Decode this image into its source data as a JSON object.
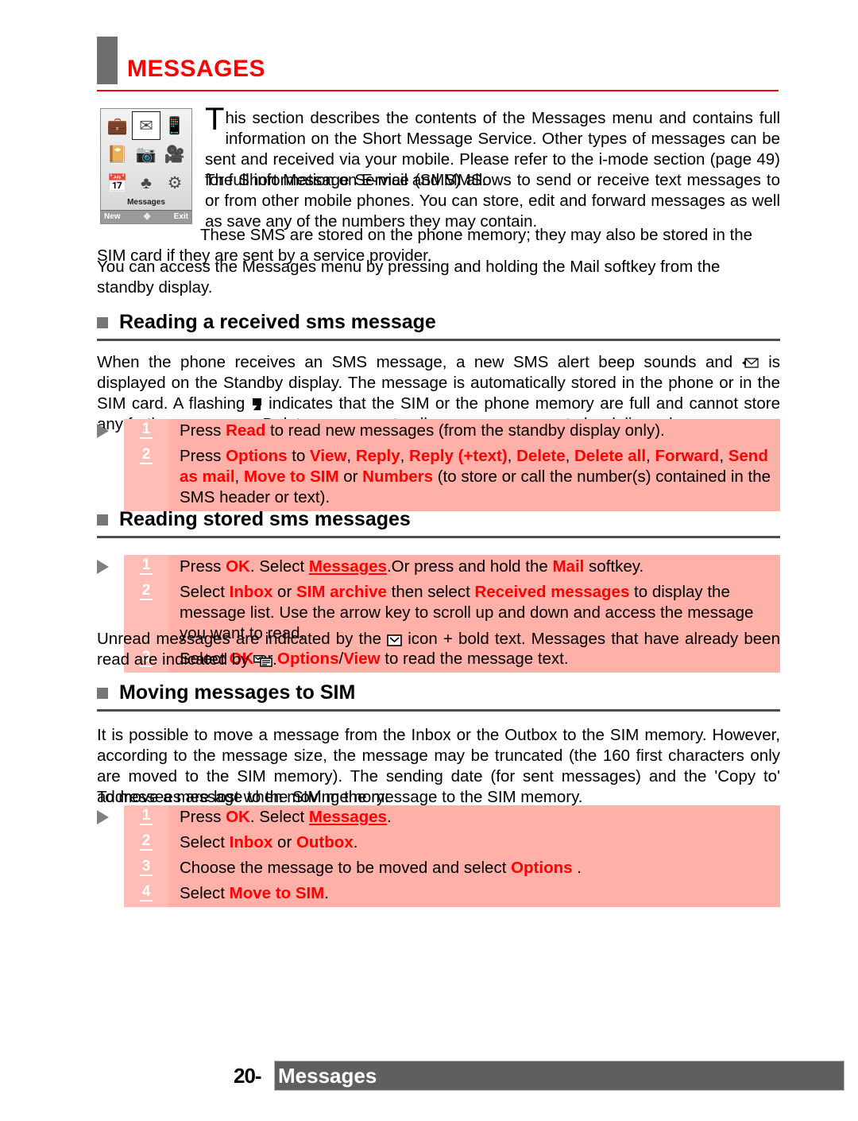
{
  "header": {
    "title": "MESSAGES"
  },
  "phone_screen": {
    "menu_label": "Messages",
    "softkey_left": "New",
    "softkey_center": "nav-pad",
    "softkey_right": "Exit",
    "icons": [
      "briefcase-icon",
      "envelope-icon",
      "phone-tools-icon",
      "notebook-icon",
      "camera-icon",
      "media-icon",
      "calendar-icon",
      "games-icon",
      "settings-icon"
    ]
  },
  "intro": {
    "dropcap": "T",
    "para1": "his section describes the contents of the Messages menu and contains full information on the Short Message Service. Other types of messages can be sent and received via your mobile. Please refer to the i-mode section (page 49) for full information on E-mail and MMS.",
    "para2": "The Short Message Service (SMS) allows to send or receive text messages to or from other mobile phones. You can store, edit and forward messages as well as save any of the numbers they may contain.",
    "para3": "These SMS are stored on the phone memory; they may also be stored in the SIM card if they are sent by a service provider.",
    "para4": "You can access the Messages menu by pressing and holding the Mail softkey from the standby display."
  },
  "section1": {
    "title": "Reading a received sms message",
    "body_pre_icon": "When the phone receives an SMS message, a new SMS alert beep sounds and ",
    "body_mid_icon": " is displayed on the Standby display. The message is automatically stored in the phone or in the SIM card. A flashing ",
    "body_post_icon": " indicates that the SIM or the phone memory are full and cannot store any further messages. Delete messages to allow new messages to be delivered.",
    "steps": [
      {
        "num": "1",
        "parts": [
          {
            "t": "Press ",
            "s": "n"
          },
          {
            "t": "Read",
            "s": "r"
          },
          {
            "t": "  to read new messages (from the standby display only).",
            "s": "n"
          }
        ]
      },
      {
        "num": "2",
        "parts": [
          {
            "t": "Press ",
            "s": "n"
          },
          {
            "t": "Options",
            "s": "r"
          },
          {
            "t": " to ",
            "s": "n"
          },
          {
            "t": "View",
            "s": "r"
          },
          {
            "t": ", ",
            "s": "n"
          },
          {
            "t": "Reply",
            "s": "r"
          },
          {
            "t": ", ",
            "s": "n"
          },
          {
            "t": "Reply (+text)",
            "s": "r"
          },
          {
            "t": ", ",
            "s": "n"
          },
          {
            "t": "Delete",
            "s": "r"
          },
          {
            "t": ", ",
            "s": "n"
          },
          {
            "t": "Delete all",
            "s": "r"
          },
          {
            "t": ", ",
            "s": "n"
          },
          {
            "t": "Forward",
            "s": "r"
          },
          {
            "t": ", ",
            "s": "n"
          },
          {
            "t": "Send as mail",
            "s": "r"
          },
          {
            "t": ", ",
            "s": "n"
          },
          {
            "t": "Move to SIM",
            "s": "r"
          },
          {
            "t": " or ",
            "s": "n"
          },
          {
            "t": "Numbers",
            "s": "r"
          },
          {
            "t": " (to store or call the number(s) contained in the SMS header or text).",
            "s": "n"
          }
        ]
      }
    ]
  },
  "section2": {
    "title": "Reading stored sms messages",
    "steps": [
      {
        "num": "1",
        "parts": [
          {
            "t": "Press ",
            "s": "n"
          },
          {
            "t": "OK",
            "s": "r"
          },
          {
            "t": ". Select ",
            "s": "n"
          },
          {
            "t": "Messages",
            "s": "ru"
          },
          {
            "t": ".Or press and hold the ",
            "s": "n"
          },
          {
            "t": "Mail",
            "s": "r"
          },
          {
            "t": " softkey.",
            "s": "n"
          }
        ]
      },
      {
        "num": "2",
        "parts": [
          {
            "t": "Select ",
            "s": "n"
          },
          {
            "t": "Inbox",
            "s": "r"
          },
          {
            "t": " or ",
            "s": "n"
          },
          {
            "t": "SIM archive",
            "s": "r"
          },
          {
            "t": " then select ",
            "s": "n"
          },
          {
            "t": "Received messages",
            "s": "r"
          },
          {
            "t": " to display the message list. Use the arrow key to scroll up and down and access the message you want to read.",
            "s": "n"
          }
        ]
      },
      {
        "num": "3",
        "parts": [
          {
            "t": "Select ",
            "s": "n"
          },
          {
            "t": "OK",
            "s": "r"
          },
          {
            "t": " or ",
            "s": "n"
          },
          {
            "t": "Options",
            "s": "r"
          },
          {
            "t": "/",
            "s": "n"
          },
          {
            "t": "View",
            "s": "r"
          },
          {
            "t": "  to read the message text.",
            "s": "n"
          }
        ]
      }
    ],
    "after_pre_icon": "Unread messages are indicated by the ",
    "after_mid_icon": " icon + bold text. Messages that have already been read are indicated by ",
    "after_post_icon": "."
  },
  "section3": {
    "title": "Moving messages to SIM",
    "body": "It is possible to move a message from the Inbox or the Outbox to the SIM memory. However, according to the message size, the message may be truncated (the 160 first characters only are moved to the SIM memory). The sending date (for sent messages) and the 'Copy to' addressees are lost when moving the message to the SIM memory.",
    "body2": "To move a message to the SIM memory:",
    "steps": [
      {
        "num": "1",
        "parts": [
          {
            "t": "Press ",
            "s": "n"
          },
          {
            "t": "OK",
            "s": "r"
          },
          {
            "t": ". Select ",
            "s": "n"
          },
          {
            "t": "Messages",
            "s": "ru"
          },
          {
            "t": ".",
            "s": "n"
          }
        ]
      },
      {
        "num": "2",
        "parts": [
          {
            "t": "Select ",
            "s": "n"
          },
          {
            "t": "Inbox",
            "s": "r"
          },
          {
            "t": " or ",
            "s": "n"
          },
          {
            "t": "Outbox",
            "s": "r"
          },
          {
            "t": ".",
            "s": "n"
          }
        ]
      },
      {
        "num": "3",
        "parts": [
          {
            "t": "Choose the message to be moved and select ",
            "s": "n"
          },
          {
            "t": "Options",
            "s": "r"
          },
          {
            "t": " .",
            "s": "n"
          }
        ]
      },
      {
        "num": "4",
        "parts": [
          {
            "t": "Select ",
            "s": "n"
          },
          {
            "t": "Move to SIM",
            "s": "r"
          },
          {
            "t": ".",
            "s": "n"
          }
        ]
      }
    ]
  },
  "footer": {
    "page_number": "20-",
    "label": "Messages"
  },
  "colors": {
    "accent_red": "#ff0000",
    "step_box_pink": "#ffb0a8",
    "step_num_pink": "#ffbdb5",
    "gray_bar": "#5f5f5f",
    "bullet_gray": "#767676"
  }
}
